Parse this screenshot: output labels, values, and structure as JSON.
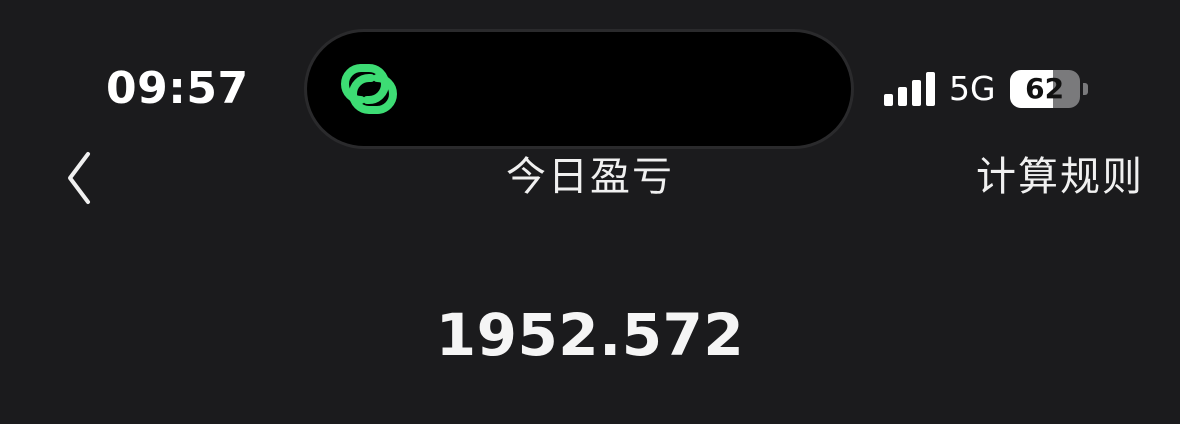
{
  "status_bar": {
    "time": "09:57",
    "network": "5G",
    "battery_level": "62",
    "battery_fraction": 0.62,
    "signal_bars": 4,
    "island_icon": "link-rings-icon",
    "island_icon_color": "#3ddc74"
  },
  "nav": {
    "back_icon": "chevron-left-icon",
    "title": "今日盈亏",
    "rule_label": "计算规则"
  },
  "main": {
    "pnl_value": "1952.572"
  }
}
